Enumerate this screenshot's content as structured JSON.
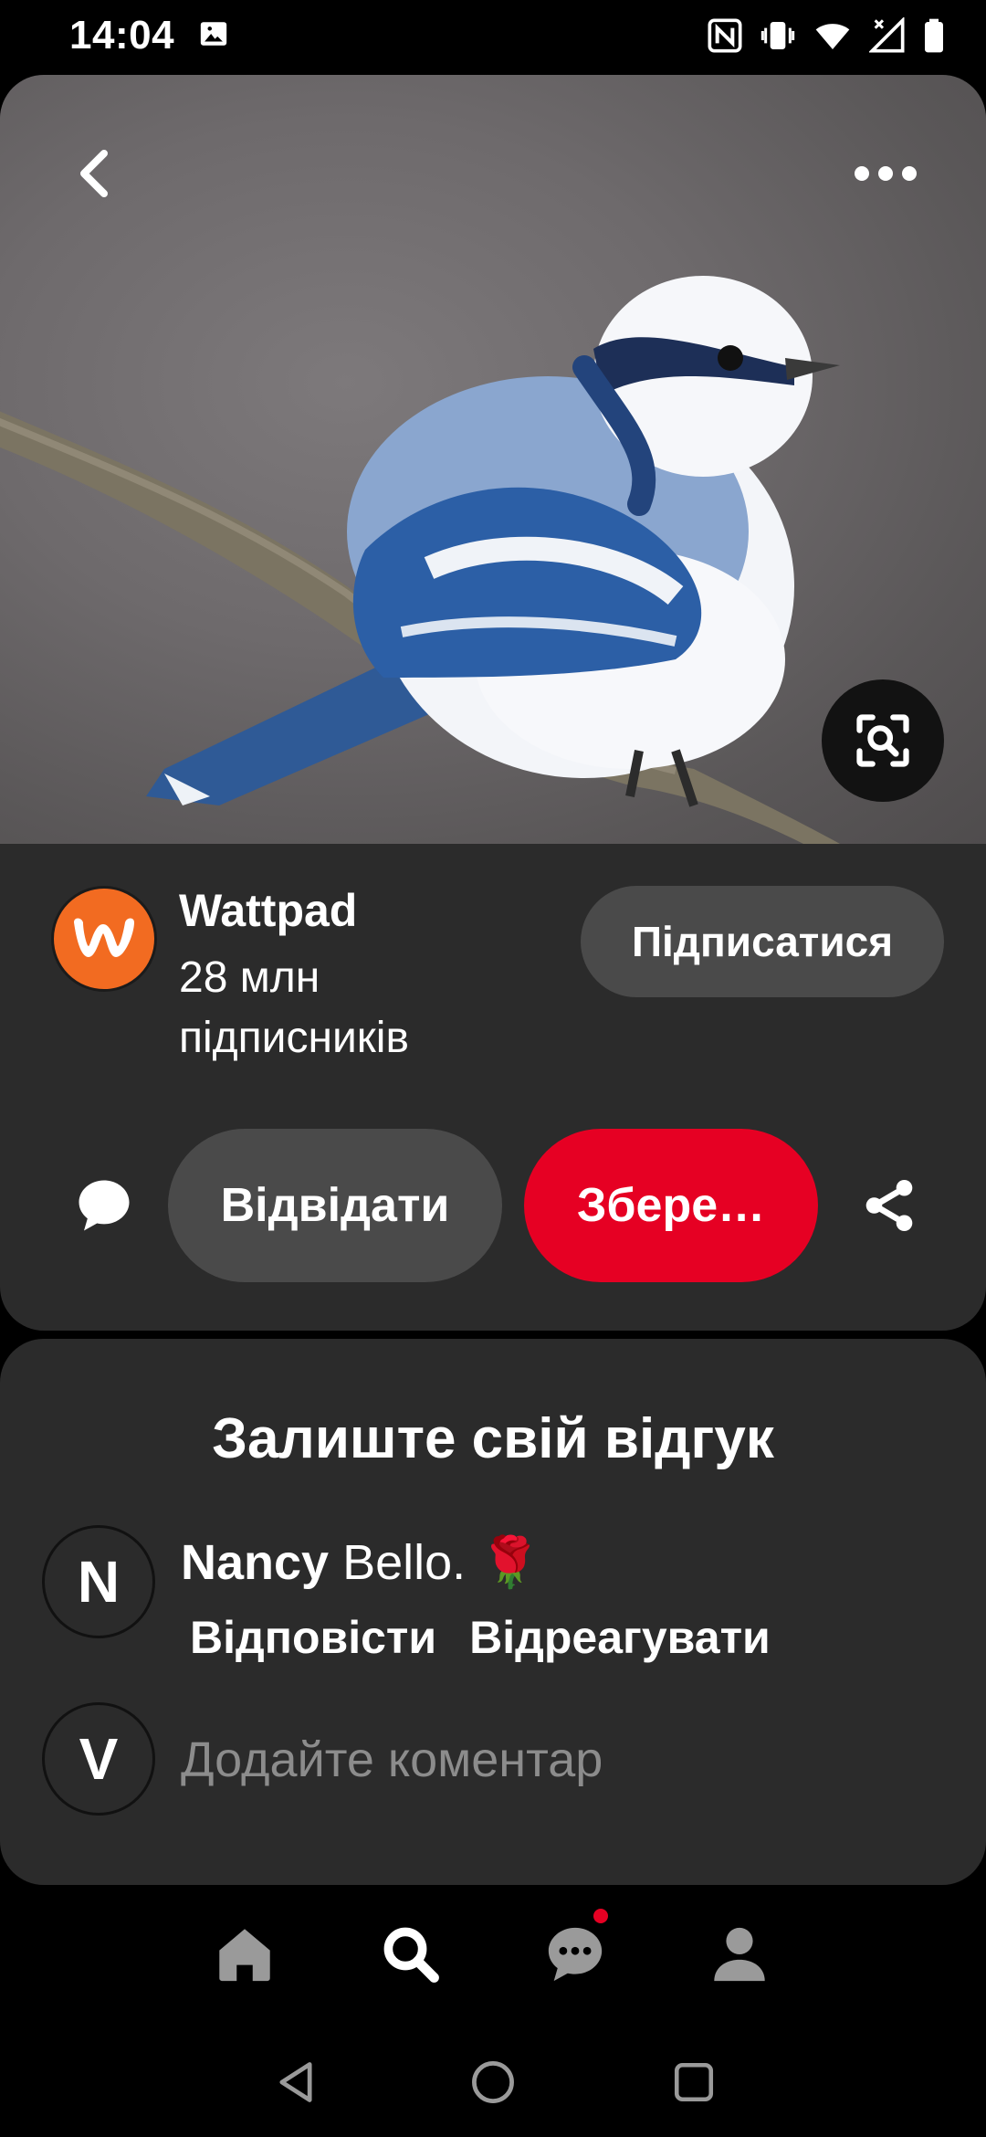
{
  "status_bar": {
    "time": "14:04",
    "icons": [
      "image-icon",
      "nfc-icon",
      "vibrate-icon",
      "wifi-icon",
      "signal-icon",
      "battery-icon"
    ]
  },
  "pin": {
    "image_alt": "bird-photo",
    "creator": {
      "name": "Wattpad",
      "followers": "28 млн підписників",
      "follow_label": "Підписатися"
    },
    "actions": {
      "visit_label": "Відвідати",
      "save_label": "Збере…"
    }
  },
  "comments": {
    "title": "Залиште свій відгук",
    "items": [
      {
        "avatar_letter": "N",
        "author": "Nancy",
        "text": " Bello. 🌹",
        "reply_label": "Відповісти",
        "react_label": "Відреагувати"
      }
    ],
    "current_user_letter": "V",
    "add_placeholder": "Додайте коментар"
  },
  "colors": {
    "accent_red": "#e60023",
    "card_bg": "#2b2b2b",
    "button_gray": "#4a4a4a",
    "wattpad_orange": "#f26b21"
  },
  "bottom_nav": [
    "home-icon",
    "search-icon",
    "messages-icon",
    "profile-icon"
  ],
  "system_nav": [
    "back-triangle-icon",
    "home-circle-icon",
    "recents-square-icon"
  ]
}
